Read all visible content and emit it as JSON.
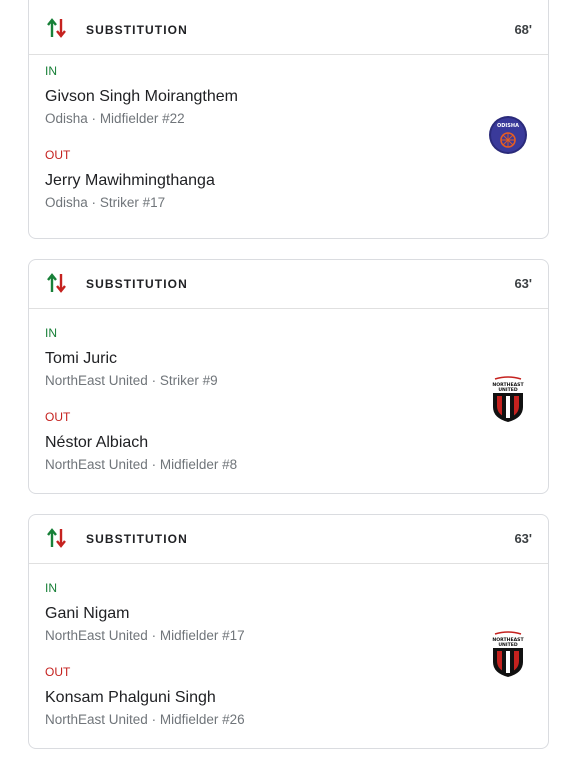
{
  "events": [
    {
      "title": "SUBSTITUTION",
      "minute": "68'",
      "in_label": "IN",
      "in_name": "Givson Singh Moirangthem",
      "in_team": "Odisha",
      "in_role": "Midfielder #22",
      "out_label": "OUT",
      "out_name": "Jerry Mawihmingthanga",
      "out_team": "Odisha",
      "out_role": "Striker #17",
      "logo": "odisha-crest",
      "logo_text": "ODISHA"
    },
    {
      "title": "SUBSTITUTION",
      "minute": "63'",
      "in_label": "IN",
      "in_name": "Tomi Juric",
      "in_team": "NorthEast United",
      "in_role": "Striker #9",
      "out_label": "OUT",
      "out_name": "Néstor Albiach",
      "out_team": "NorthEast United",
      "out_role": "Midfielder #8",
      "logo": "northeast-united-crest",
      "logo_text": "NORTHEAST UNITED"
    },
    {
      "title": "SUBSTITUTION",
      "minute": "63'",
      "in_label": "IN",
      "in_name": "Gani Nigam",
      "in_team": "NorthEast United",
      "in_role": "Midfielder #17",
      "out_label": "OUT",
      "out_name": "Konsam Phalguni Singh",
      "out_team": "NorthEast United",
      "out_role": "Midfielder #26",
      "logo": "northeast-united-crest",
      "logo_text": "NORTHEAST UNITED"
    }
  ],
  "separator": "·",
  "colors": {
    "in": "#188038",
    "out": "#c5221f",
    "border": "#dadce0"
  }
}
